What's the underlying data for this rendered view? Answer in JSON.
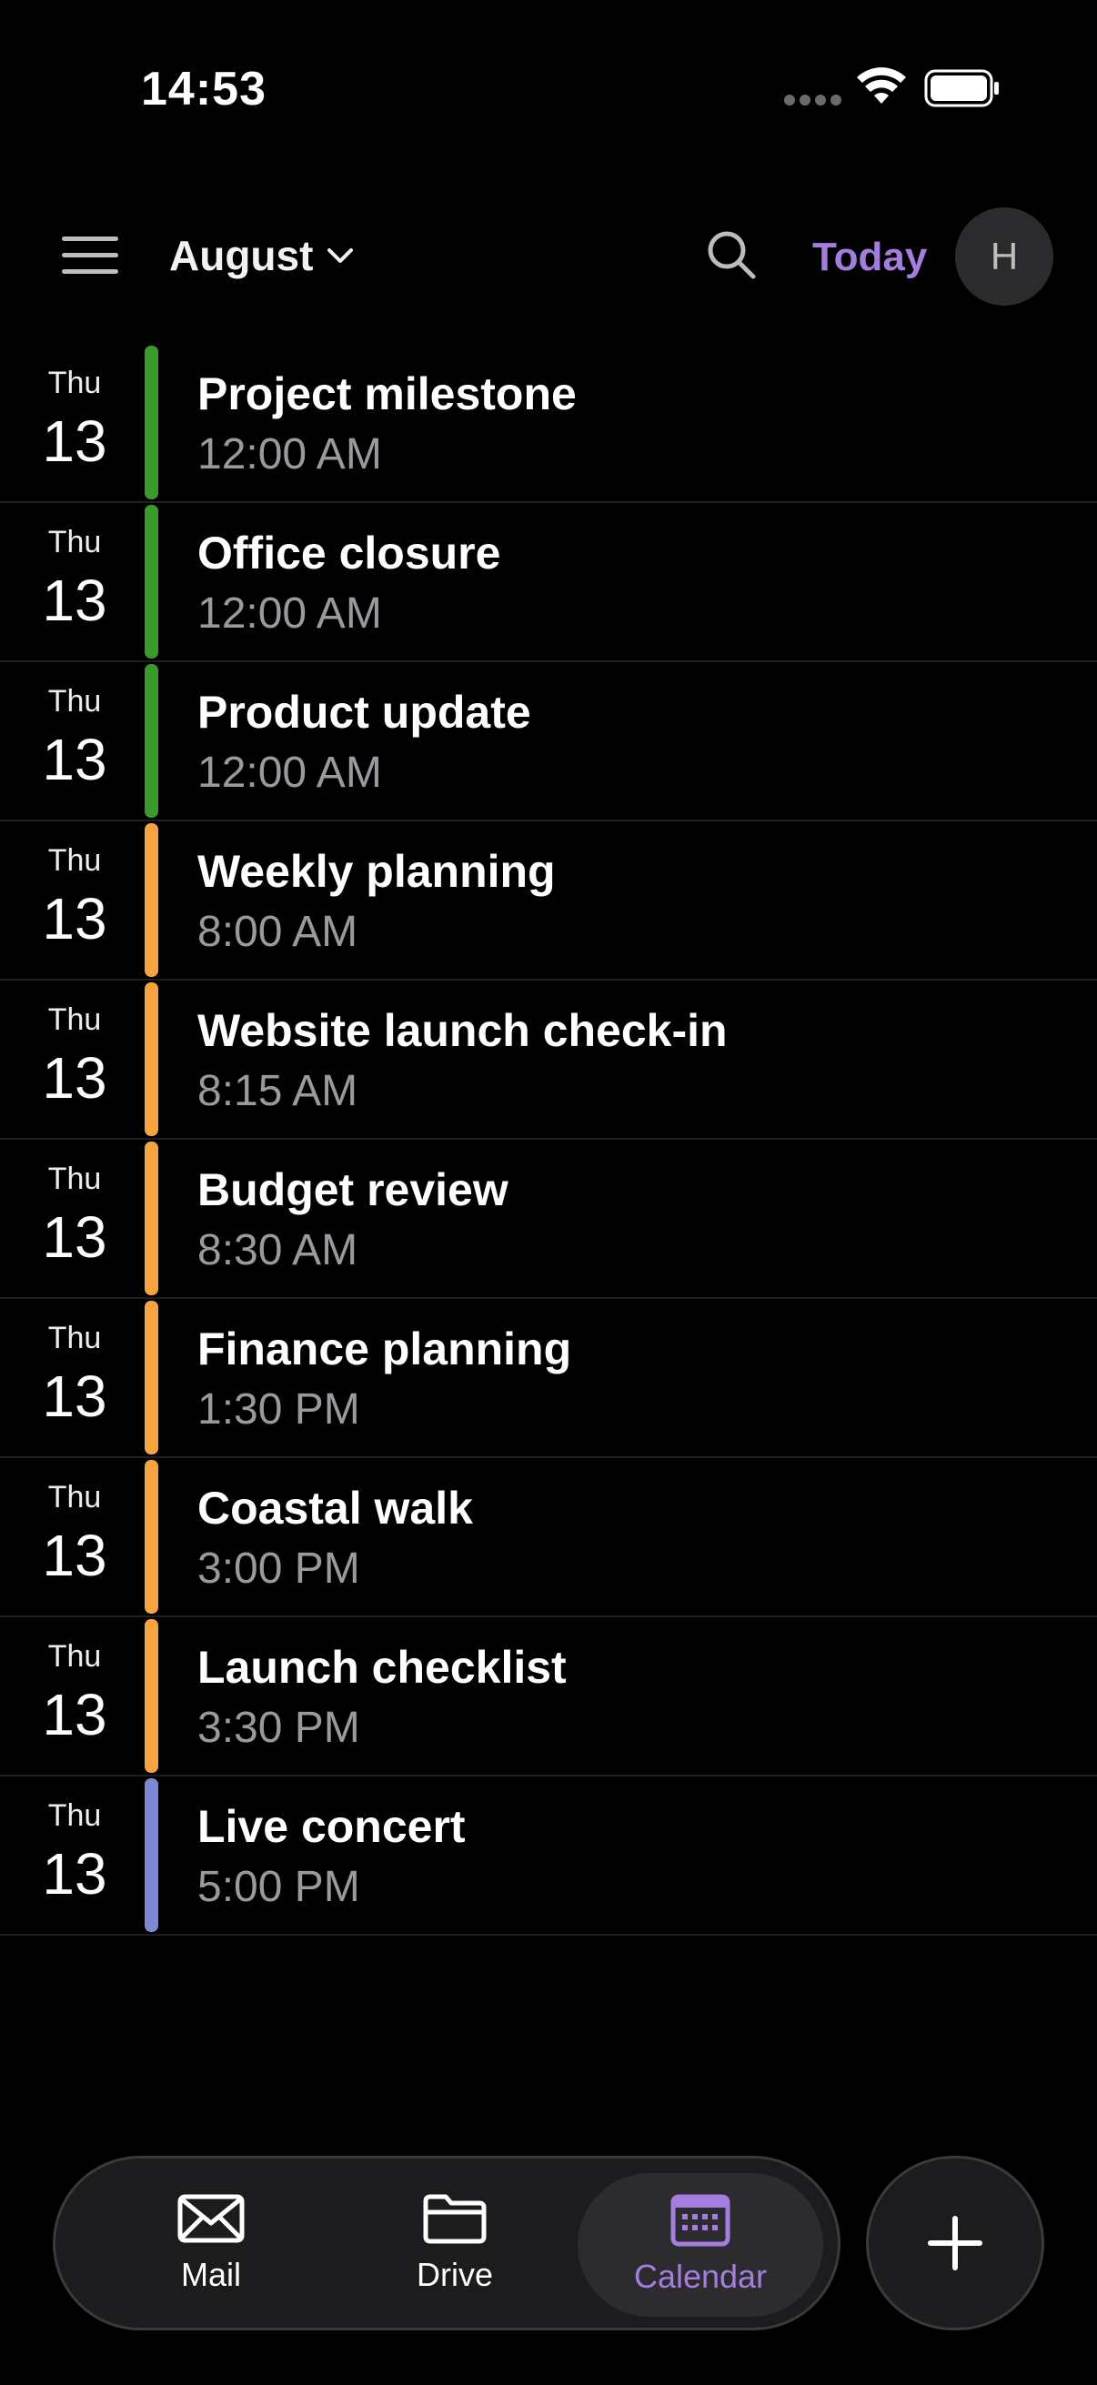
{
  "status_bar": {
    "time": "14:53"
  },
  "header": {
    "month": "August",
    "today_label": "Today",
    "avatar_initial": "H"
  },
  "colors": {
    "accent": "#a57de0",
    "green": "#3a9a2c",
    "orange": "#f7a43f",
    "lavender": "#7d88d6"
  },
  "events": [
    {
      "day": "Thu",
      "date": "13",
      "title": "Project milestone",
      "time": "12:00 AM",
      "color": "#3a9a2c"
    },
    {
      "day": "Thu",
      "date": "13",
      "title": "Office closure",
      "time": "12:00 AM",
      "color": "#3a9a2c"
    },
    {
      "day": "Thu",
      "date": "13",
      "title": "Product update",
      "time": "12:00 AM",
      "color": "#3a9a2c"
    },
    {
      "day": "Thu",
      "date": "13",
      "title": "Weekly planning",
      "time": "8:00 AM",
      "color": "#f7a43f"
    },
    {
      "day": "Thu",
      "date": "13",
      "title": "Website launch check-in",
      "time": "8:15 AM",
      "color": "#f7a43f"
    },
    {
      "day": "Thu",
      "date": "13",
      "title": "Budget review",
      "time": "8:30 AM",
      "color": "#f7a43f"
    },
    {
      "day": "Thu",
      "date": "13",
      "title": "Finance planning",
      "time": "1:30 PM",
      "color": "#f7a43f"
    },
    {
      "day": "Thu",
      "date": "13",
      "title": "Coastal walk",
      "time": "3:00 PM",
      "color": "#f7a43f"
    },
    {
      "day": "Thu",
      "date": "13",
      "title": "Launch checklist",
      "time": "3:30 PM",
      "color": "#f7a43f"
    },
    {
      "day": "Thu",
      "date": "13",
      "title": "Live concert",
      "time": "5:00 PM",
      "color": "#7d88d6"
    }
  ],
  "tabs": [
    {
      "label": "Mail",
      "icon": "mail-icon",
      "active": false
    },
    {
      "label": "Drive",
      "icon": "folder-icon",
      "active": false
    },
    {
      "label": "Calendar",
      "icon": "calendar-icon",
      "active": true
    }
  ],
  "fab_icon": "plus-icon"
}
